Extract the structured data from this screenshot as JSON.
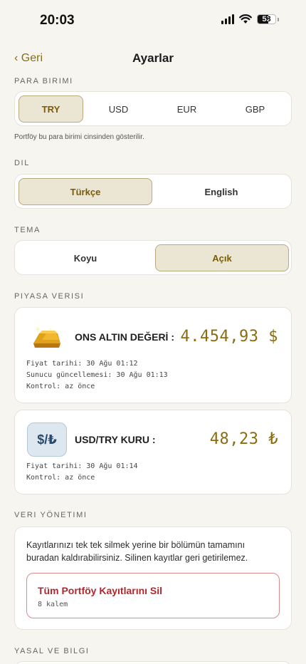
{
  "status_bar": {
    "time": "20:03",
    "battery": "53"
  },
  "nav": {
    "back_label": "‹ Geri",
    "title": "Ayarlar"
  },
  "currency": {
    "section_label": "PARA BIRIMI",
    "options": [
      "TRY",
      "USD",
      "EUR",
      "GBP"
    ],
    "selected": "TRY",
    "hint": "Portföy bu para birimi cinsinden gösterilir."
  },
  "language": {
    "section_label": "DIL",
    "options": [
      "Türkçe",
      "English"
    ],
    "selected": "Türkçe"
  },
  "theme": {
    "section_label": "TEMA",
    "options": [
      "Koyu",
      "Açık"
    ],
    "selected": "Açık"
  },
  "market": {
    "section_label": "PIYASA VERISI",
    "gold": {
      "title": "ONS ALTIN DEĞERİ :",
      "value": "4.454,93 $",
      "lines": [
        "Fiyat tarihi: 30 Ağu 01:12",
        "Sunucu güncellemesi: 30 Ağu 01:13",
        "Kontrol: az önce"
      ]
    },
    "fx": {
      "icon_text": "$/₺",
      "title": "USD/TRY KURU :",
      "value": "48,23 ₺",
      "lines": [
        "Fiyat tarihi: 30 Ağu 01:14",
        "Kontrol: az önce"
      ]
    }
  },
  "data_management": {
    "section_label": "VERI YÖNETIMI",
    "description": "Kayıtlarınızı tek tek silmek yerine bir bölümün tamamını buradan kaldırabilirsiniz. Silinen kayıtlar geri getirilemez.",
    "delete_button": {
      "title": "Tüm Portföy Kayıtlarını Sil",
      "subtitle": "8 kalem"
    }
  },
  "legal": {
    "section_label": "YASAL VE BILGI"
  },
  "colors": {
    "accent": "#8a6d10",
    "background": "#f7f5f0",
    "danger": "#b3262c",
    "selected_bg": "#ebe6d3"
  }
}
